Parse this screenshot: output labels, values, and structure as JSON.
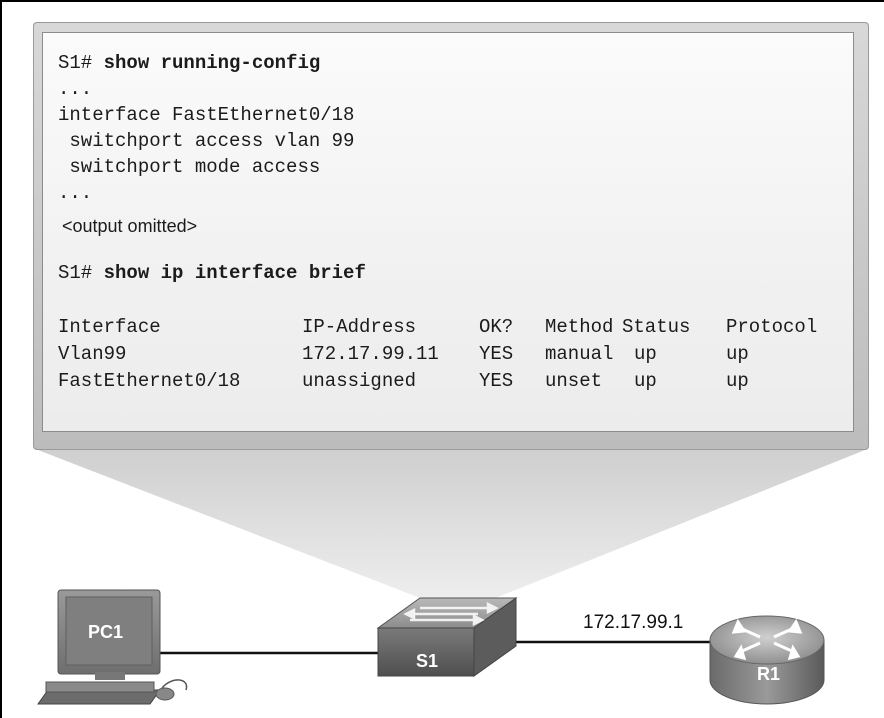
{
  "terminal": {
    "prompt1": "S1# ",
    "command1": "show running-config",
    "ellipsis1": "...",
    "line_interface": "interface FastEthernet0/18",
    "line_vlan": " switchport access vlan 99",
    "line_mode": " switchport mode access",
    "ellipsis2": "...",
    "omitted": "<output omitted>",
    "prompt2": "S1# ",
    "command2": "show ip interface brief",
    "table": {
      "headers": [
        "Interface",
        "IP-Address",
        "OK?",
        "Method",
        "Status",
        "Protocol"
      ],
      "rows": [
        [
          "Vlan99",
          "172.17.99.11",
          "YES",
          "manual",
          "up",
          "up"
        ],
        [
          "FastEthernet0/18",
          "unassigned",
          "YES",
          "unset",
          "up",
          "up"
        ]
      ]
    }
  },
  "topology": {
    "pc_label": "PC1",
    "switch_label": "S1",
    "router_label": "R1",
    "link_ip": "172.17.99.1"
  }
}
